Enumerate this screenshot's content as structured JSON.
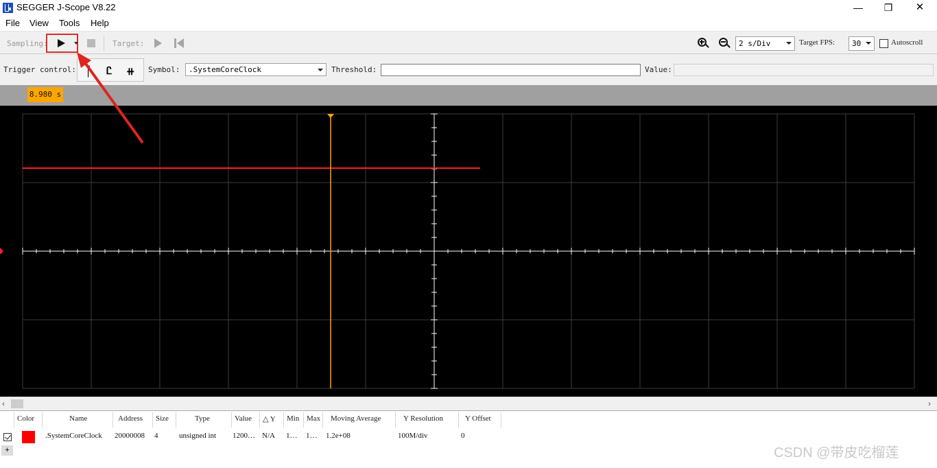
{
  "window": {
    "title": "SEGGER J-Scope V8.22",
    "minimize": "—",
    "maximize": "❐",
    "close": "✕"
  },
  "menu": [
    "File",
    "View",
    "Tools",
    "Help"
  ],
  "toolbar": {
    "sampling_label": "Sampling:",
    "target_label": "Target:",
    "time_per_div": "2 s/Div",
    "target_fps_label": "Target FPS:",
    "target_fps": "30",
    "autoscroll_label": "Autoscroll"
  },
  "trigger": {
    "label": "Trigger control:",
    "symbol_label": "Symbol:",
    "symbol": ".SystemCoreClock",
    "threshold_label": "Threshold:",
    "threshold": "",
    "value_label": "Value:",
    "value": ""
  },
  "scope": {
    "time_marker": "8.980 s",
    "colors": {
      "background": "#000000",
      "grid": "#3c3c3c",
      "axis": "#ffffff",
      "signal": "#ff2020",
      "cursor": "#ffa500"
    },
    "signal_level_divisions": 2.0,
    "signal_end_divisions": 6.67,
    "cursor_divisions": 4.5
  },
  "table": {
    "headers": [
      "Color",
      "Name",
      "Address",
      "Size",
      "Type",
      "Value",
      "△ Y",
      "Min",
      "Max",
      "Moving Average",
      "Y Resolution",
      "Y Offset"
    ],
    "rows": [
      {
        "checked": true,
        "color": "#ff0000",
        "name": ".SystemCoreClock",
        "address": "20000008",
        "size": "4",
        "type": "unsigned int",
        "value": "1200…",
        "delta_y": "N/A",
        "min": "1…",
        "max": "1…",
        "moving_average": "1.2e+08",
        "y_resolution": "100M/div",
        "y_offset": "0"
      }
    ],
    "add_label": "+"
  },
  "watermark": "CSDN @带皮吃榴莲"
}
